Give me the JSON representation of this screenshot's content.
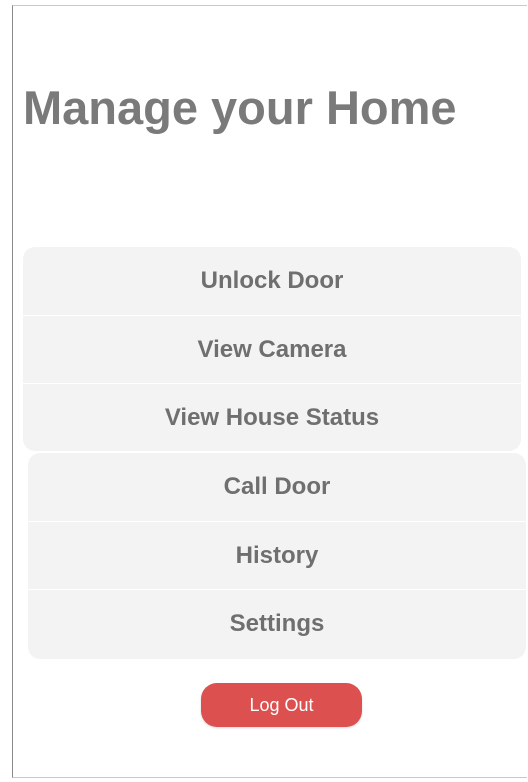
{
  "page": {
    "title": "Manage your Home"
  },
  "menu_group_1": {
    "items": [
      {
        "label": "Unlock Door"
      },
      {
        "label": "View Camera"
      },
      {
        "label": "View House Status"
      }
    ]
  },
  "menu_group_2": {
    "items": [
      {
        "label": "Call Door"
      },
      {
        "label": "History"
      },
      {
        "label": "Settings"
      }
    ]
  },
  "logout": {
    "label": "Log Out",
    "color": "#dc5050"
  },
  "colors": {
    "title_text": "#7a7a7a",
    "menu_background": "#f3f3f3",
    "menu_text": "#6f6f6f"
  }
}
